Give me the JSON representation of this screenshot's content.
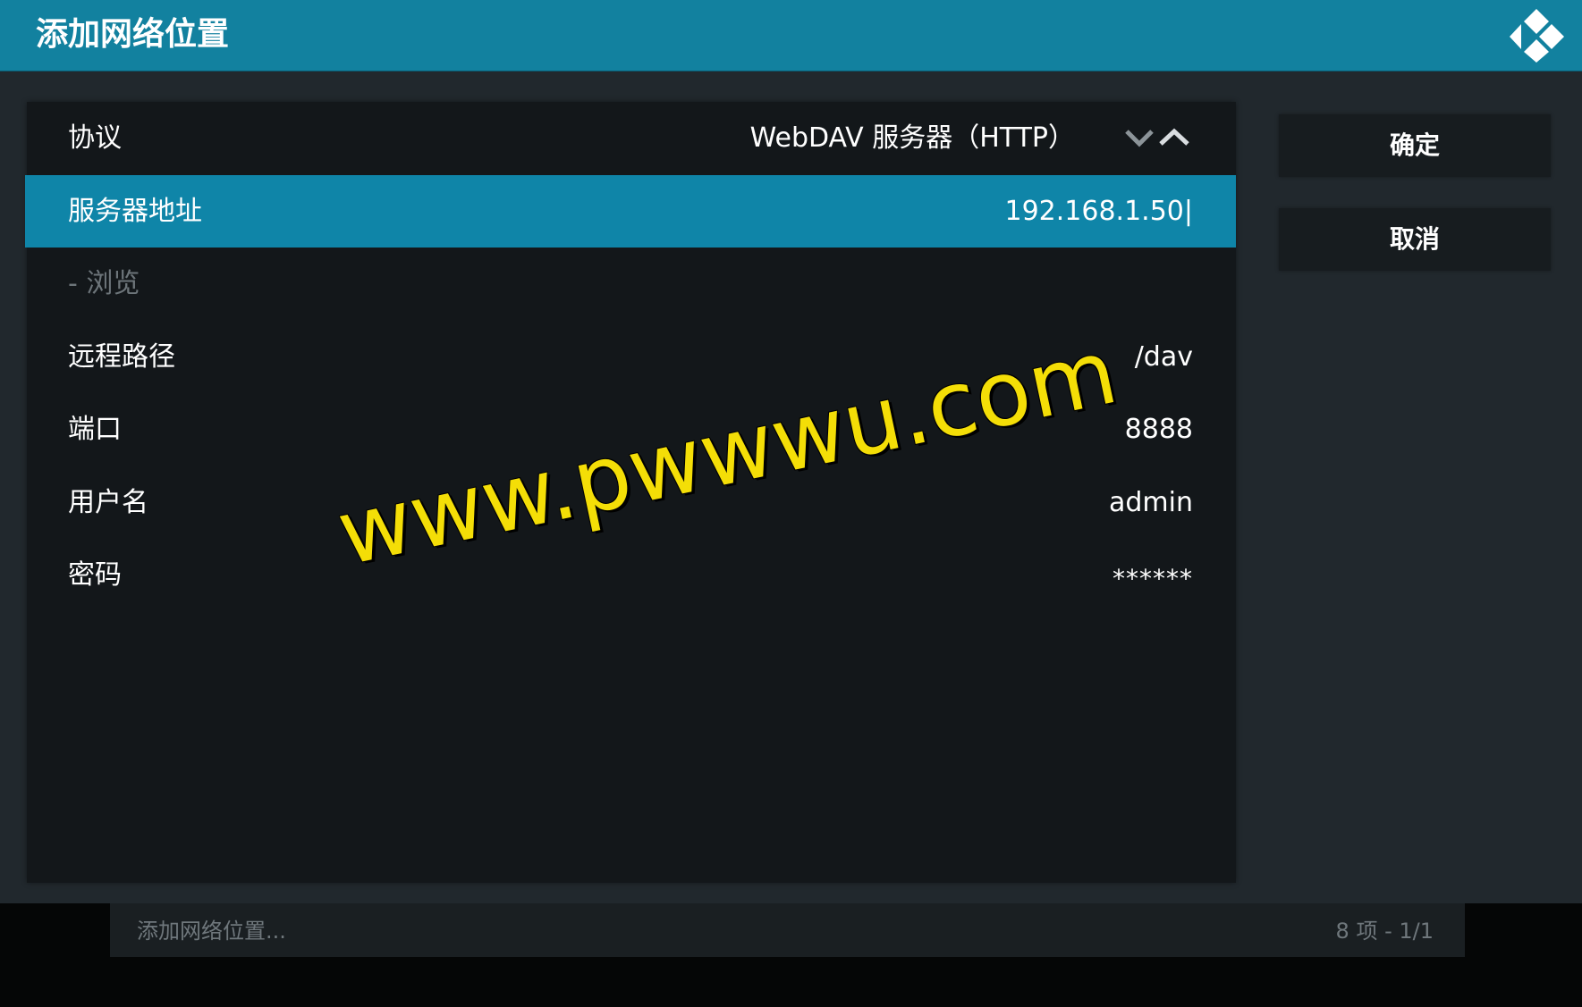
{
  "header": {
    "title": "添加网络位置"
  },
  "settings": {
    "protocol": {
      "label": "协议",
      "value": "WebDAV 服务器（HTTP）"
    },
    "server_address": {
      "label": "服务器地址",
      "value": "192.168.1.50|"
    },
    "browse": {
      "label": "- 浏览"
    },
    "remote_path": {
      "label": "远程路径",
      "value": "/dav"
    },
    "port": {
      "label": "端口",
      "value": "8888"
    },
    "username": {
      "label": "用户名",
      "value": "admin"
    },
    "password": {
      "label": "密码",
      "value": "******"
    }
  },
  "buttons": {
    "ok_label": "确定",
    "cancel_label": "取消"
  },
  "footer": {
    "left_text": "添加网络位置...",
    "right_text": "8 项 - 1/1"
  },
  "watermark": {
    "text": "www.pwwwu.com"
  },
  "icons": {
    "logo": "kodi-logo-icon",
    "spinner_down": "chevron-down-icon",
    "spinner_up": "chevron-up-icon"
  },
  "colors": {
    "header_bg": "#12819f",
    "focus_bg": "#0f85a8",
    "panel_bg": "#13171a",
    "page_bg": "#21282d",
    "watermark": "#f4de07"
  }
}
